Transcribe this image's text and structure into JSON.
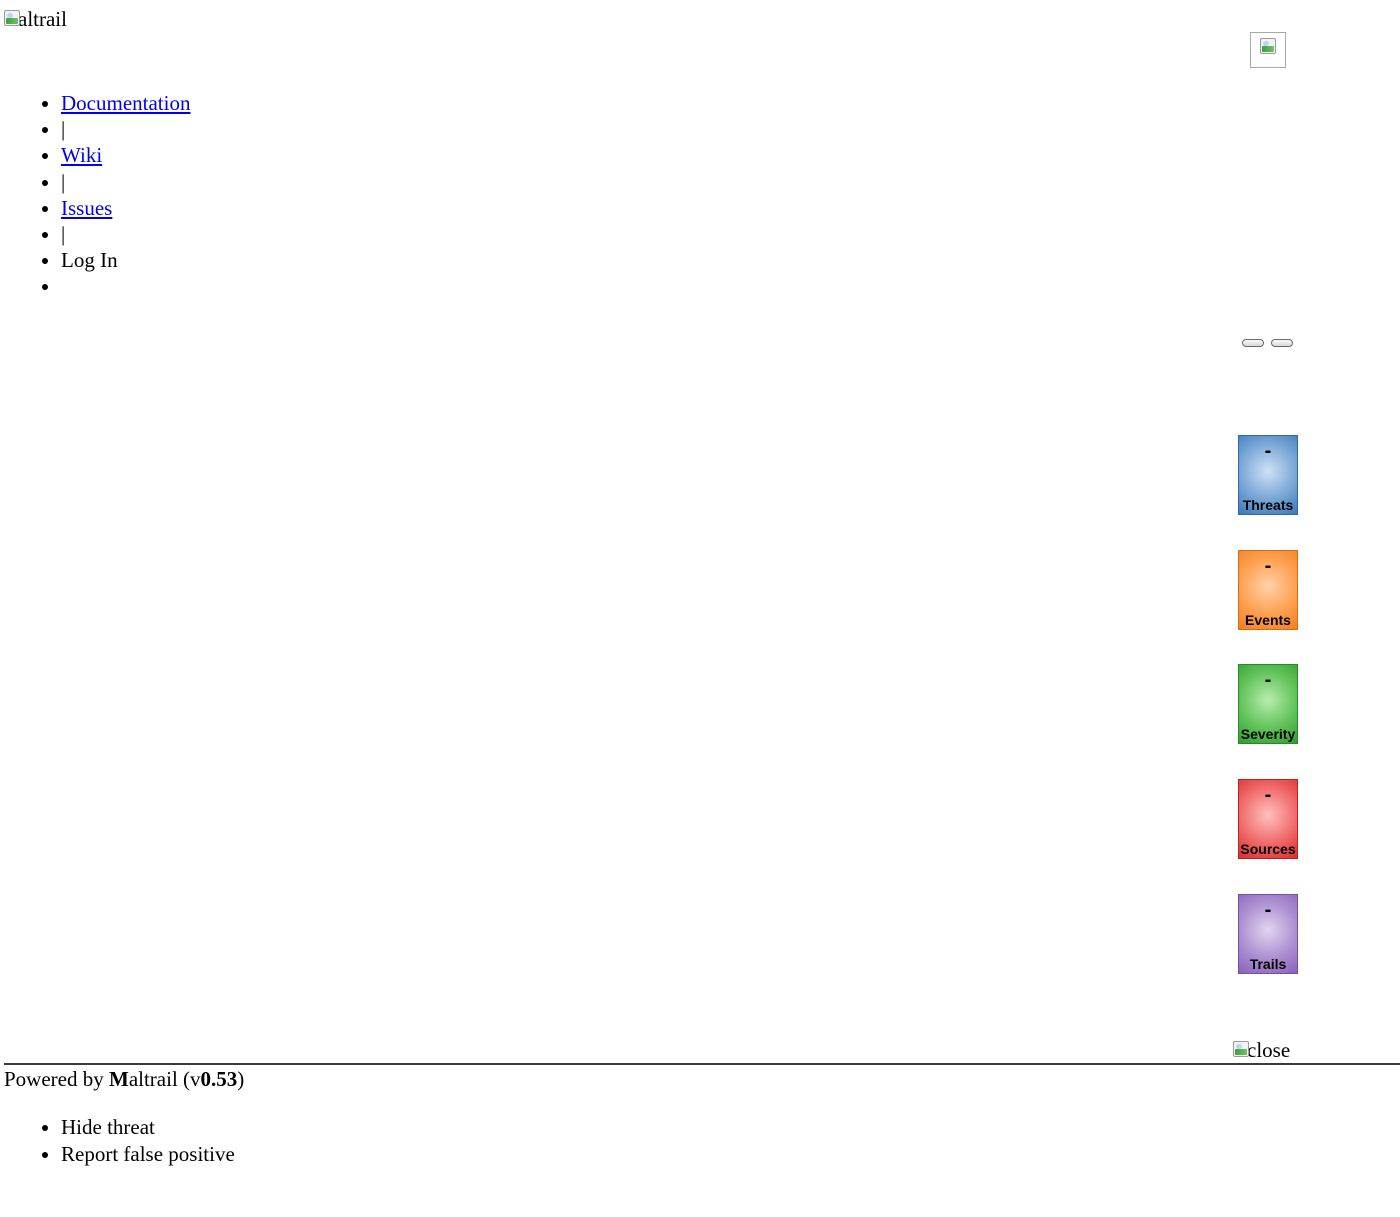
{
  "header": {
    "logo_alt": "altrail",
    "nav": [
      {
        "label": "Documentation",
        "type": "link"
      },
      {
        "label": "|",
        "type": "separator"
      },
      {
        "label": "Wiki",
        "type": "link"
      },
      {
        "label": "|",
        "type": "separator"
      },
      {
        "label": "Issues",
        "type": "link"
      },
      {
        "label": "|",
        "type": "separator"
      },
      {
        "label": "Log In",
        "type": "text"
      },
      {
        "label": "",
        "type": "empty"
      }
    ]
  },
  "stats": {
    "tiles": [
      {
        "key": "threats",
        "value": "-",
        "label": "Threats",
        "color": "#4a86c5"
      },
      {
        "key": "events",
        "value": "-",
        "label": "Events",
        "color": "#ff8c2e"
      },
      {
        "key": "severity",
        "value": "-",
        "label": "Severity",
        "color": "#3fae3a"
      },
      {
        "key": "sources",
        "value": "-",
        "label": "Sources",
        "color": "#e64545"
      },
      {
        "key": "trails",
        "value": "-",
        "label": "Trails",
        "color": "#9b78c8"
      }
    ]
  },
  "overlay": {
    "close_alt": "close"
  },
  "footer": {
    "powered_by": "Powered by ",
    "brand_initial": "M",
    "brand_rest": "altrail",
    "version_prefix": " (v",
    "version": "0.53",
    "version_suffix": ")"
  },
  "context_menu": {
    "items": [
      "Hide threat",
      "Report false positive"
    ]
  }
}
